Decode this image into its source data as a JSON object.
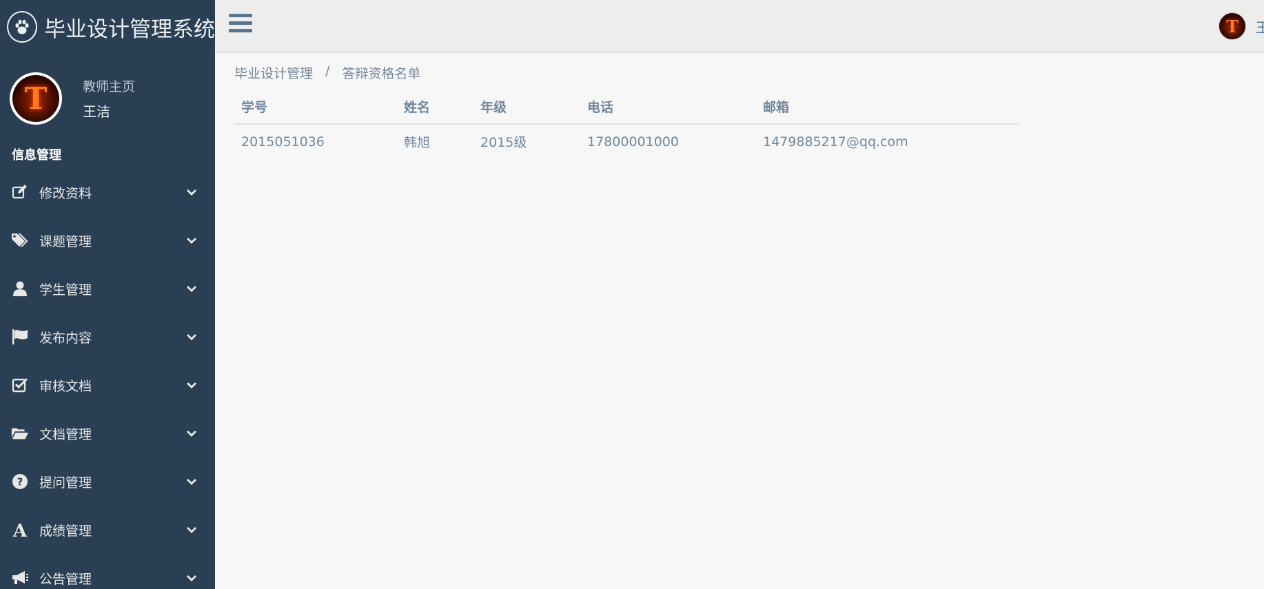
{
  "app": {
    "title": "毕业设计管理系统"
  },
  "profile": {
    "role": "教师主页",
    "name": "王洁"
  },
  "sidebar": {
    "section_title": "信息管理",
    "items": [
      {
        "label": "修改资料",
        "icon": "edit-icon"
      },
      {
        "label": "课题管理",
        "icon": "tags-icon"
      },
      {
        "label": "学生管理",
        "icon": "user-icon"
      },
      {
        "label": "发布内容",
        "icon": "flag-icon"
      },
      {
        "label": "审核文档",
        "icon": "check-square-icon"
      },
      {
        "label": "文档管理",
        "icon": "folder-open-icon"
      },
      {
        "label": "提问管理",
        "icon": "question-circle-icon"
      },
      {
        "label": "成绩管理",
        "icon": "font-icon"
      },
      {
        "label": "公告管理",
        "icon": "bullhorn-icon"
      }
    ]
  },
  "topnav": {
    "user_name": "王洁"
  },
  "breadcrumb": {
    "parent": "毕业设计管理",
    "separator": "/",
    "current": "答辩资格名单"
  },
  "table": {
    "headers": [
      "学号",
      "姓名",
      "年级",
      "电话",
      "邮箱"
    ],
    "rows": [
      [
        "2015051036",
        "韩旭",
        "2015级",
        "17800001000",
        "1479885217@qq.com"
      ]
    ]
  },
  "colors": {
    "sidebar_bg": "#2a3f54",
    "text_muted": "#73879c",
    "accent": "#5a738e"
  }
}
